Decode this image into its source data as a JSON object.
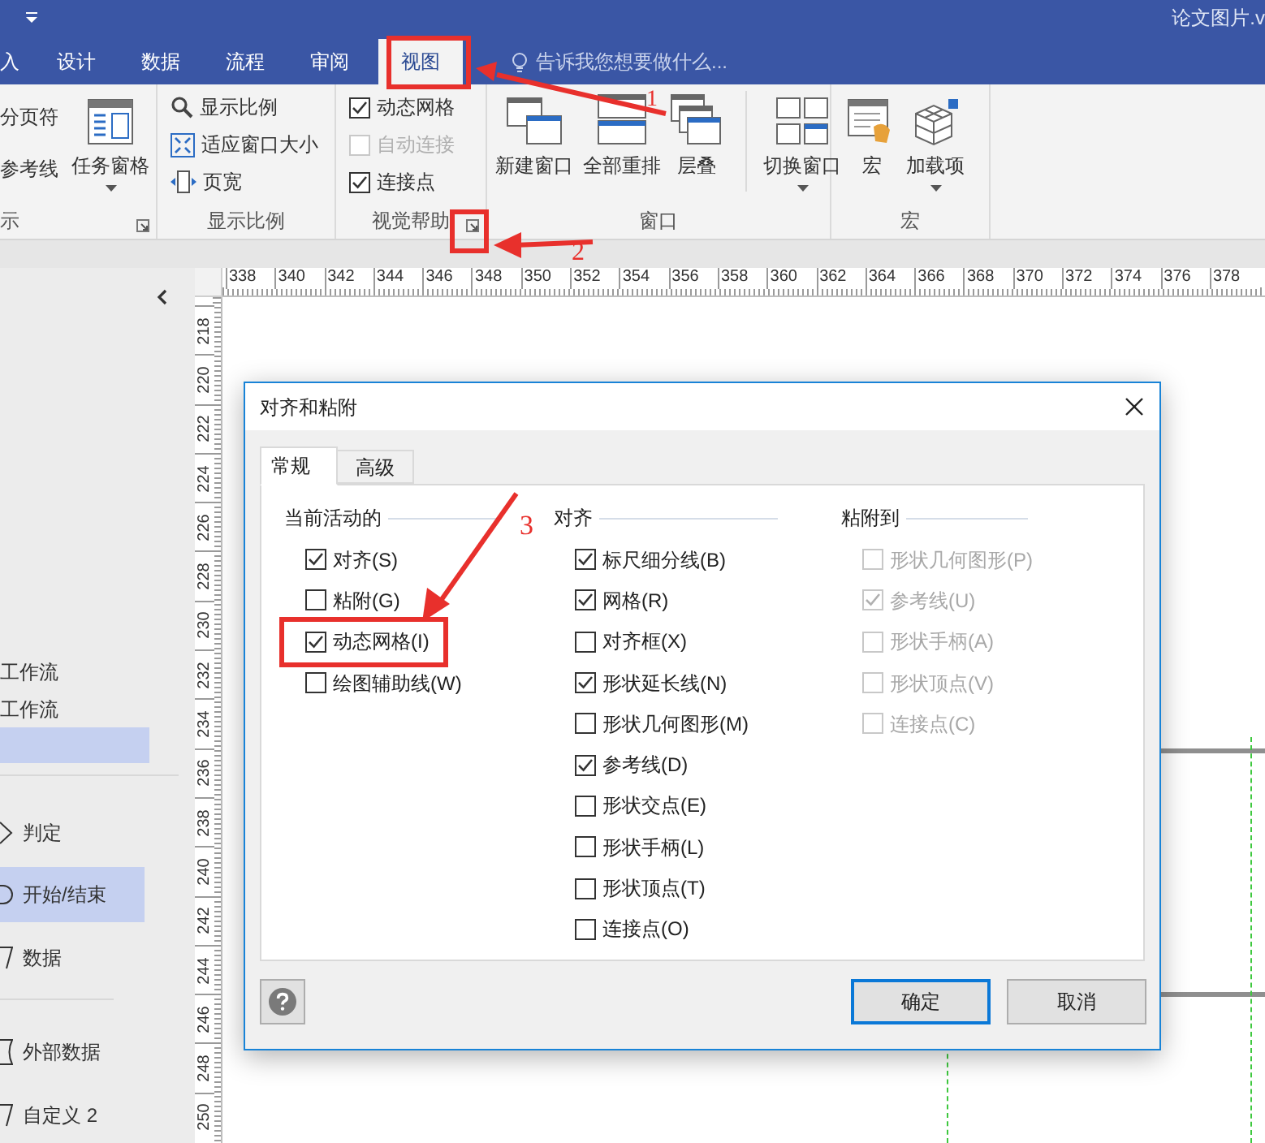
{
  "window": {
    "title": "论文图片.v"
  },
  "tabs": [
    {
      "label": "入",
      "selected": false
    },
    {
      "label": "设计",
      "selected": false
    },
    {
      "label": "数据",
      "selected": false
    },
    {
      "label": "流程",
      "selected": false
    },
    {
      "label": "审阅",
      "selected": false
    },
    {
      "label": "视图",
      "selected": true
    }
  ],
  "search": {
    "placeholder": "告诉我您想要做什么..."
  },
  "ribbon": {
    "groups": [
      {
        "label": "示",
        "launcher": true,
        "items": [
          {
            "kind": "small",
            "label": "分页符"
          },
          {
            "kind": "small",
            "label": "参考线"
          },
          {
            "kind": "large",
            "label": "任务窗格",
            "dropdown": true
          }
        ]
      },
      {
        "label": "显示比例",
        "launcher": false,
        "items": [
          {
            "kind": "small",
            "label": "显示比例"
          },
          {
            "kind": "small",
            "label": "适应窗口大小"
          },
          {
            "kind": "small",
            "label": "页宽"
          }
        ]
      },
      {
        "label": "视觉帮助",
        "launcher": true,
        "items": [
          {
            "kind": "check",
            "label": "动态网格",
            "checked": true,
            "disabled": false
          },
          {
            "kind": "check",
            "label": "自动连接",
            "checked": false,
            "disabled": true
          },
          {
            "kind": "check",
            "label": "连接点",
            "checked": true,
            "disabled": false
          }
        ]
      },
      {
        "label": "窗口",
        "launcher": false,
        "items": [
          {
            "kind": "large",
            "label": "新建窗口",
            "dropdown": false
          },
          {
            "kind": "large",
            "label": "全部重排",
            "dropdown": false
          },
          {
            "kind": "large",
            "label": "层叠",
            "dropdown": false
          },
          {
            "kind": "large",
            "label": "切换窗口",
            "dropdown": true
          }
        ]
      },
      {
        "label": "宏",
        "launcher": false,
        "items": [
          {
            "kind": "large",
            "label": "宏",
            "dropdown": false
          },
          {
            "kind": "large",
            "label": "加载项",
            "dropdown": true
          }
        ]
      }
    ]
  },
  "sidebar": {
    "items": [
      {
        "kind": "text",
        "label": "工作流",
        "selected": false
      },
      {
        "kind": "text",
        "label": "工作流",
        "selected": false
      },
      {
        "kind": "blank",
        "selected": true
      },
      {
        "kind": "shape",
        "label": "判定",
        "selected": false
      },
      {
        "kind": "shape",
        "label": "开始/结束",
        "selected": true
      },
      {
        "kind": "shape",
        "label": "数据",
        "selected": false
      },
      {
        "kind": "shape",
        "label": "外部数据",
        "selected": false
      },
      {
        "kind": "shape",
        "label": "自定义 2",
        "selected": false
      }
    ]
  },
  "ruler": {
    "horizontal": [
      "338",
      "340",
      "342",
      "344",
      "346",
      "348",
      "350",
      "352",
      "354",
      "356",
      "358",
      "360",
      "362",
      "364",
      "366",
      "368",
      "370",
      "372",
      "374",
      "376",
      "378"
    ],
    "vertical": [
      "218",
      "220",
      "222",
      "224",
      "226",
      "228",
      "230",
      "232",
      "234",
      "236",
      "238",
      "240",
      "242",
      "244",
      "246",
      "248",
      "250"
    ]
  },
  "dialog": {
    "title": "对齐和粘附",
    "tabs": [
      {
        "label": "常规",
        "selected": true
      },
      {
        "label": "高级",
        "selected": false
      }
    ],
    "groups": [
      {
        "title": "当前活动的",
        "options": [
          {
            "label": "对齐(S)",
            "checked": true,
            "disabled": false
          },
          {
            "label": "粘附(G)",
            "checked": false,
            "disabled": false
          },
          {
            "label": "动态网格(I)",
            "checked": true,
            "disabled": false
          },
          {
            "label": "绘图辅助线(W)",
            "checked": false,
            "disabled": false
          }
        ]
      },
      {
        "title": "对齐",
        "options": [
          {
            "label": "标尺细分线(B)",
            "checked": true,
            "disabled": false
          },
          {
            "label": "网格(R)",
            "checked": true,
            "disabled": false
          },
          {
            "label": "对齐框(X)",
            "checked": false,
            "disabled": false
          },
          {
            "label": "形状延长线(N)",
            "checked": true,
            "disabled": false
          },
          {
            "label": "形状几何图形(M)",
            "checked": false,
            "disabled": false
          },
          {
            "label": "参考线(D)",
            "checked": true,
            "disabled": false
          },
          {
            "label": "形状交点(E)",
            "checked": false,
            "disabled": false
          },
          {
            "label": "形状手柄(L)",
            "checked": false,
            "disabled": false
          },
          {
            "label": "形状顶点(T)",
            "checked": false,
            "disabled": false
          },
          {
            "label": "连接点(O)",
            "checked": false,
            "disabled": false
          }
        ]
      },
      {
        "title": "粘附到",
        "options": [
          {
            "label": "形状几何图形(P)",
            "checked": false,
            "disabled": true
          },
          {
            "label": "参考线(U)",
            "checked": true,
            "disabled": true
          },
          {
            "label": "形状手柄(A)",
            "checked": false,
            "disabled": true
          },
          {
            "label": "形状顶点(V)",
            "checked": false,
            "disabled": true
          },
          {
            "label": "连接点(C)",
            "checked": false,
            "disabled": true
          }
        ]
      }
    ],
    "buttons": [
      {
        "label": "确定",
        "default": true
      },
      {
        "label": "取消",
        "default": false
      }
    ]
  },
  "annotations": [
    {
      "label": "1"
    },
    {
      "label": "2"
    },
    {
      "label": "3"
    }
  ]
}
